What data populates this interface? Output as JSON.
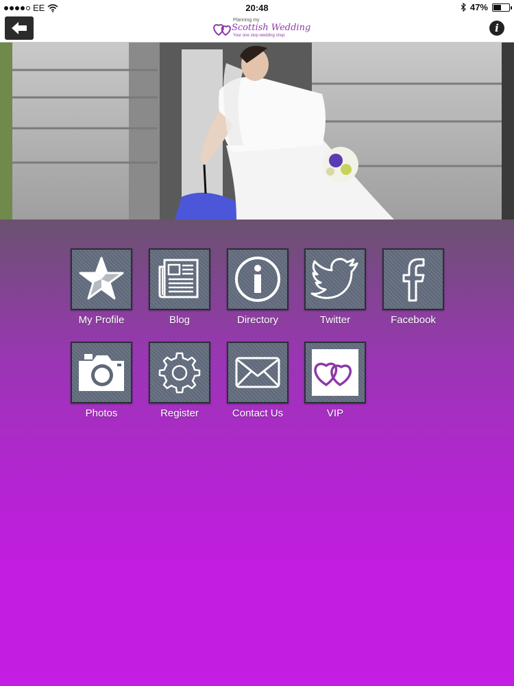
{
  "status_bar": {
    "carrier": "EE",
    "time": "20:48",
    "battery": "47%",
    "battery_level": 0.47
  },
  "nav": {
    "back_icon": "back-arrow-icon",
    "logo": {
      "line1": "Planning my",
      "line2": "Scottish Wedding",
      "line3": "Your one stop wedding shop"
    },
    "info_label": "i"
  },
  "menu": {
    "items": [
      {
        "label": "My Profile",
        "icon": "star-icon"
      },
      {
        "label": "Blog",
        "icon": "newspaper-icon"
      },
      {
        "label": "Directory",
        "icon": "info-circle-icon"
      },
      {
        "label": "Twitter",
        "icon": "twitter-bird-icon"
      },
      {
        "label": "Facebook",
        "icon": "facebook-icon"
      },
      {
        "label": "Photos",
        "icon": "camera-icon"
      },
      {
        "label": "Register",
        "icon": "gear-icon"
      },
      {
        "label": "Contact Us",
        "icon": "envelope-icon"
      },
      {
        "label": "VIP",
        "icon": "hearts-logo-icon"
      }
    ]
  },
  "colors": {
    "accent": "#8c3aa8",
    "gradient_top": "#6a5270",
    "gradient_bottom": "#c41de3",
    "tile": "#636d7d"
  }
}
